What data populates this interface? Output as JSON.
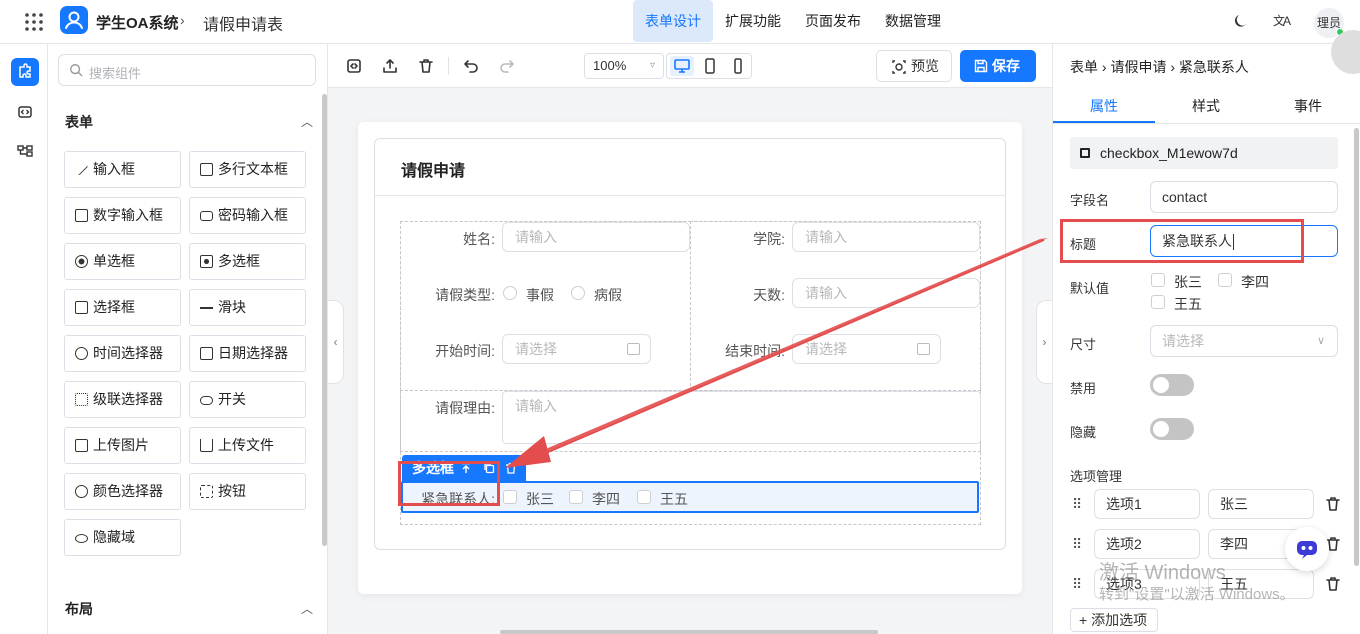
{
  "topbar": {
    "app_name": "学生OA系统",
    "breadcrumb_sep": "›",
    "page_title": "请假申请表",
    "nav_tabs": [
      {
        "label": "表单设计",
        "active": true
      },
      {
        "label": "扩展功能",
        "active": false
      },
      {
        "label": "页面发布",
        "active": false
      },
      {
        "label": "数据管理",
        "active": false
      }
    ],
    "lang_glyph": "文A",
    "user": "理员",
    "accent": "#1677ff"
  },
  "components": {
    "search_placeholder": "搜索组件",
    "section_form": "表单",
    "section_layout": "布局",
    "items": [
      {
        "label": "输入框",
        "icon": "pencil-icon"
      },
      {
        "label": "多行文本框",
        "icon": "textarea-icon"
      },
      {
        "label": "数字输入框",
        "icon": "number-icon"
      },
      {
        "label": "密码输入框",
        "icon": "lock-icon"
      },
      {
        "label": "单选框",
        "icon": "radio-icon"
      },
      {
        "label": "多选框",
        "icon": "checkbox-icon"
      },
      {
        "label": "选择框",
        "icon": "select-icon"
      },
      {
        "label": "滑块",
        "icon": "slider-icon"
      },
      {
        "label": "时间选择器",
        "icon": "clock-icon"
      },
      {
        "label": "日期选择器",
        "icon": "calendar-icon"
      },
      {
        "label": "级联选择器",
        "icon": "cascader-icon"
      },
      {
        "label": "开关",
        "icon": "switch-icon"
      },
      {
        "label": "上传图片",
        "icon": "image-icon"
      },
      {
        "label": "上传文件",
        "icon": "upload-icon"
      },
      {
        "label": "颜色选择器",
        "icon": "palette-icon"
      },
      {
        "label": "按钮",
        "icon": "button-icon"
      },
      {
        "label": "隐藏域",
        "icon": "eye-off-icon"
      }
    ]
  },
  "toolbar": {
    "zoom": "100%",
    "preview": "预览",
    "save": "保存"
  },
  "form": {
    "title": "请假申请",
    "name_label": "姓名:",
    "name_placeholder": "请输入",
    "college_label": "学院:",
    "college_placeholder": "请输入",
    "type_label": "请假类型:",
    "type_options": [
      "事假",
      "病假"
    ],
    "days_label": "天数:",
    "days_placeholder": "请输入",
    "start_label": "开始时间:",
    "start_placeholder": "请选择",
    "end_label": "结束时间:",
    "end_placeholder": "请选择",
    "reason_label": "请假理由:",
    "reason_placeholder": "请输入",
    "selected_chip": "多选框",
    "contact_label": "紧急联系人:",
    "contact_options": [
      "张三",
      "李四",
      "王五"
    ]
  },
  "props": {
    "breadcrumb": "表单 › 请假申请 › 紧急联系人",
    "tabs": [
      "属性",
      "样式",
      "事件"
    ],
    "component_id": "checkbox_M1ewow7d",
    "field_name_label": "字段名",
    "field_name_value": "contact",
    "title_label": "标题",
    "title_value": "紧急联系人",
    "default_label": "默认值",
    "default_options": [
      "张三",
      "李四",
      "王五"
    ],
    "size_label": "尺寸",
    "size_placeholder": "请选择",
    "disabled_label": "禁用",
    "hidden_label": "隐藏",
    "options_label": "选项管理",
    "options": [
      {
        "key": "选项1",
        "value": "张三"
      },
      {
        "key": "选项2",
        "value": "李四"
      },
      {
        "key": "选项3",
        "value": "王五"
      }
    ],
    "add_option": "+ 添加选项"
  },
  "watermark": {
    "line1": "激活 Windows",
    "line2": "转到\"设置\"以激活 Windows。"
  },
  "annotation_color": "#e34d4d"
}
